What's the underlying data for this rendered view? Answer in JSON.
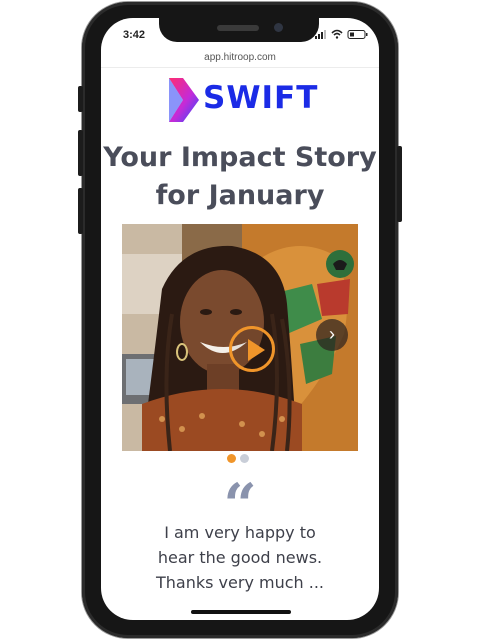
{
  "status_bar": {
    "time": "3:42"
  },
  "browser": {
    "url": "app.hitroop.com"
  },
  "brand": {
    "name": "SWIFT",
    "color": "#1b2be6"
  },
  "headline": {
    "line1": "Your Impact Story",
    "line2": "for January"
  },
  "media": {
    "play_icon": "play-icon",
    "next_icon": "chevron-right-icon"
  },
  "carousel": {
    "active_index": 0,
    "count": 2,
    "active_color": "#f0952a",
    "inactive_color": "#c9ced8"
  },
  "testimonial": {
    "quote_mark": "“",
    "line1": "I am very happy to",
    "line2": "hear the good news.",
    "line3": "Thanks very much ..."
  }
}
